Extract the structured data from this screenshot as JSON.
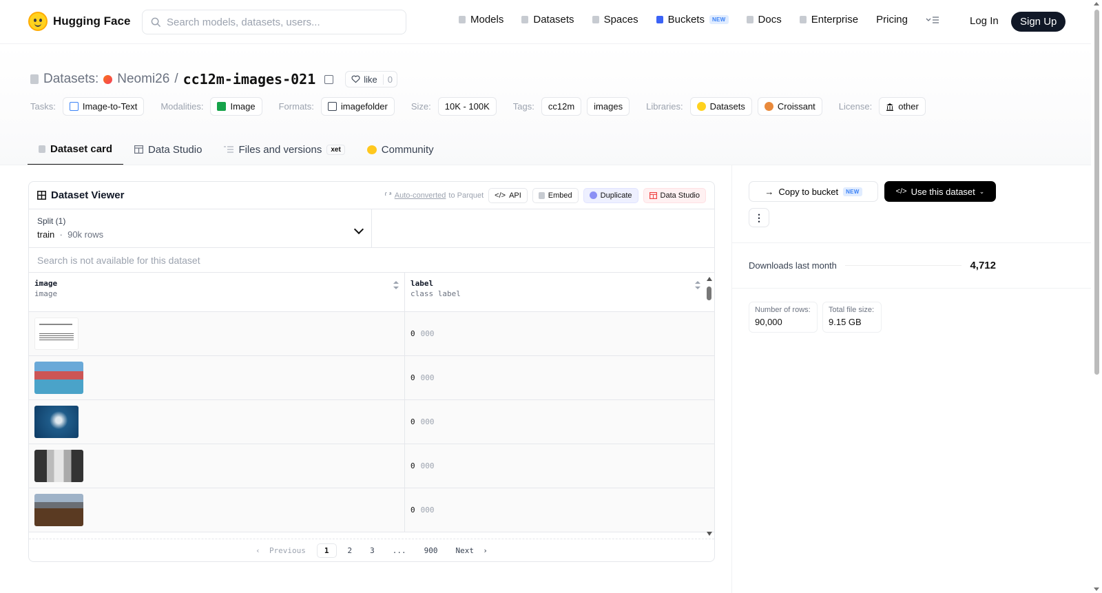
{
  "nav": {
    "brand": "Hugging Face",
    "search_placeholder": "Search models, datasets, users...",
    "links": {
      "models": "Models",
      "datasets": "Datasets",
      "spaces": "Spaces",
      "buckets": "Buckets",
      "buckets_badge": "NEW",
      "docs": "Docs",
      "enterprise": "Enterprise",
      "pricing": "Pricing"
    },
    "login": "Log In",
    "signup": "Sign Up"
  },
  "header": {
    "section": "Datasets:",
    "owner": "Neomi26",
    "separator": "/",
    "name": "cc12m-images-021",
    "like_label": "like",
    "like_count": "0",
    "tags": {
      "tasks_label": "Tasks:",
      "task": "Image-to-Text",
      "modalities_label": "Modalities:",
      "modality": "Image",
      "formats_label": "Formats:",
      "format": "imagefolder",
      "size_label": "Size:",
      "size": "10K - 100K",
      "tags_label": "Tags:",
      "tag1": "cc12m",
      "tag2": "images",
      "libraries_label": "Libraries:",
      "lib1": "Datasets",
      "lib2": "Croissant",
      "license_label": "License:",
      "license": "other"
    }
  },
  "tabs": {
    "card": "Dataset card",
    "studio": "Data Studio",
    "files": "Files and versions",
    "xet": "xet",
    "community": "Community"
  },
  "viewer": {
    "title": "Dataset Viewer",
    "auto_converted": "Auto-converted",
    "to_parquet": "to Parquet",
    "api": "API",
    "embed": "Embed",
    "duplicate": "Duplicate",
    "data_studio": "Data Studio",
    "split_title": "Split (1)",
    "split_value": "train",
    "split_rows": "90k rows",
    "search_disabled": "Search is not available for this dataset",
    "columns": [
      {
        "name": "image",
        "type": "image"
      },
      {
        "name": "label",
        "type": "class label"
      }
    ],
    "rows": [
      {
        "label_value": "0",
        "label_name": "000"
      },
      {
        "label_value": "0",
        "label_name": "000"
      },
      {
        "label_value": "0",
        "label_name": "000"
      },
      {
        "label_value": "0",
        "label_name": "000"
      },
      {
        "label_value": "0",
        "label_name": "000"
      }
    ],
    "pagination": {
      "previous": "Previous",
      "p1": "1",
      "p2": "2",
      "p3": "3",
      "ellipsis": "...",
      "last": "900",
      "next": "Next"
    }
  },
  "sidebar": {
    "copy_to_bucket": "Copy to bucket",
    "copy_badge": "NEW",
    "use_dataset": "Use this dataset",
    "downloads_label": "Downloads last month",
    "downloads_value": "4,712",
    "rows_label": "Number of rows:",
    "rows_value": "90,000",
    "size_label": "Total file size:",
    "size_value": "9.15 GB"
  },
  "colors": {
    "accent": "#111827",
    "brand_yellow": "#ffd21e"
  }
}
